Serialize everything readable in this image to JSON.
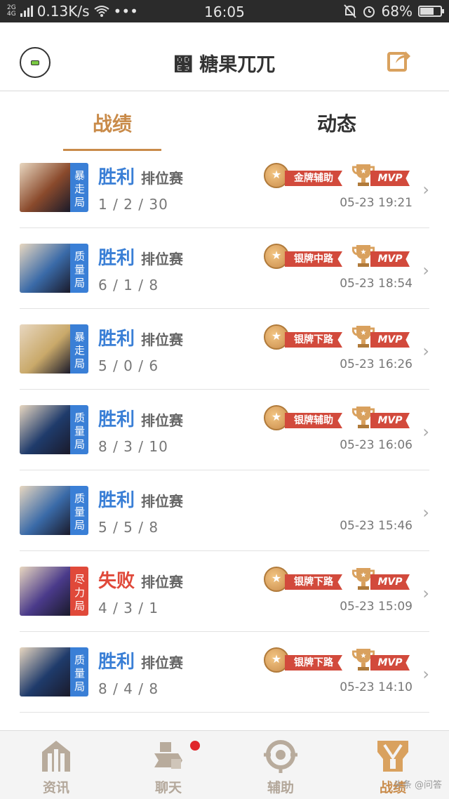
{
  "status_bar": {
    "network_top": "2G",
    "network_bottom": "4G",
    "speed": "0.13K/s",
    "more": "•••",
    "time": "16:05",
    "battery": "68%",
    "battery_level": 0.68
  },
  "header": {
    "title": "෣ 糖果兀兀"
  },
  "tabs": [
    {
      "label": "战绩",
      "active": true
    },
    {
      "label": "动态",
      "active": false
    }
  ],
  "records": [
    {
      "mode": "暴走局",
      "mode_color": "#3a7fd6",
      "result": "胜利",
      "result_type": "win",
      "match_type": "排位赛",
      "kda": "1 / 2 / 30",
      "medal": "金牌辅助",
      "mvp": "MVP",
      "time": "05-23 19:21",
      "hero_color": "#8a4a2c"
    },
    {
      "mode": "质量局",
      "mode_color": "#3a7fd6",
      "result": "胜利",
      "result_type": "win",
      "match_type": "排位赛",
      "kda": "6 / 1 / 8",
      "medal": "银牌中路",
      "mvp": "MVP",
      "time": "05-23 18:54",
      "hero_color": "#3a6aa8"
    },
    {
      "mode": "暴走局",
      "mode_color": "#3a7fd6",
      "result": "胜利",
      "result_type": "win",
      "match_type": "排位赛",
      "kda": "5 / 0 / 6",
      "medal": "银牌下路",
      "mvp": "MVP",
      "time": "05-23 16:26",
      "hero_color": "#c9a96a"
    },
    {
      "mode": "质量局",
      "mode_color": "#3a7fd6",
      "result": "胜利",
      "result_type": "win",
      "match_type": "排位赛",
      "kda": "8 / 3 / 10",
      "medal": "银牌辅助",
      "mvp": "MVP",
      "time": "05-23 16:06",
      "hero_color": "#1f3b6b"
    },
    {
      "mode": "质量局",
      "mode_color": "#3a7fd6",
      "result": "胜利",
      "result_type": "win",
      "match_type": "排位赛",
      "kda": "5 / 5 / 8",
      "medal": "",
      "mvp": "",
      "time": "05-23 15:46",
      "hero_color": "#3a6aa8"
    },
    {
      "mode": "尽力局",
      "mode_color": "#e0493a",
      "result": "失败",
      "result_type": "loss",
      "match_type": "排位赛",
      "kda": "4 / 3 / 1",
      "medal": "银牌下路",
      "mvp": "MVP",
      "time": "05-23 15:09",
      "hero_color": "#4a3a8a"
    },
    {
      "mode": "质量局",
      "mode_color": "#3a7fd6",
      "result": "胜利",
      "result_type": "win",
      "match_type": "排位赛",
      "kda": "8 / 4 / 8",
      "medal": "银牌下路",
      "mvp": "MVP",
      "time": "05-23 14:10",
      "hero_color": "#1f3b6b"
    }
  ],
  "bottom_nav": [
    {
      "label": "资讯",
      "icon": "news-icon",
      "active": false,
      "dot": false
    },
    {
      "label": "聊天",
      "icon": "chat-icon",
      "active": false,
      "dot": true
    },
    {
      "label": "辅助",
      "icon": "assist-icon",
      "active": false,
      "dot": false
    },
    {
      "label": "战绩",
      "icon": "record-icon",
      "active": true,
      "dot": false
    }
  ],
  "watermark": "头条 @问答",
  "colors": {
    "accent": "#c98b4a",
    "win": "#3a7fd6",
    "loss": "#e0493a",
    "ribbon": "#d24a3c"
  }
}
